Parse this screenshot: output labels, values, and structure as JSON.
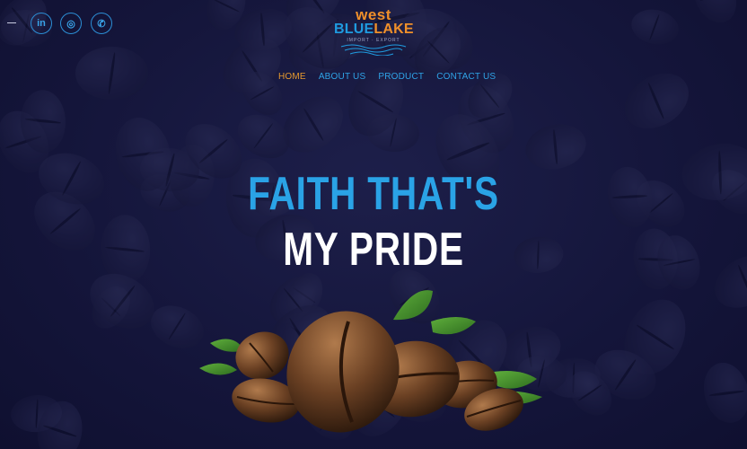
{
  "header": {
    "social": [
      {
        "icon": "linkedin-icon",
        "glyph": "in"
      },
      {
        "icon": "instagram-icon",
        "glyph": "◎"
      },
      {
        "icon": "whatsapp-icon",
        "glyph": "✆"
      }
    ],
    "logo": {
      "line1": "west",
      "line2_a": "BLUE",
      "line2_b": "LAKE",
      "line3": "IMPORT · EXPORT"
    }
  },
  "nav": {
    "items": [
      {
        "label": "HOME",
        "active": true
      },
      {
        "label": "ABOUT US",
        "active": false
      },
      {
        "label": "PRODUCT",
        "active": false
      },
      {
        "label": "CONTACT US",
        "active": false
      }
    ]
  },
  "hero": {
    "line1": "FAITH THAT'S",
    "line2": "MY PRIDE"
  },
  "colors": {
    "background": "#16173a",
    "accent_blue": "#2aa3e6",
    "accent_orange": "#e79a2e"
  }
}
